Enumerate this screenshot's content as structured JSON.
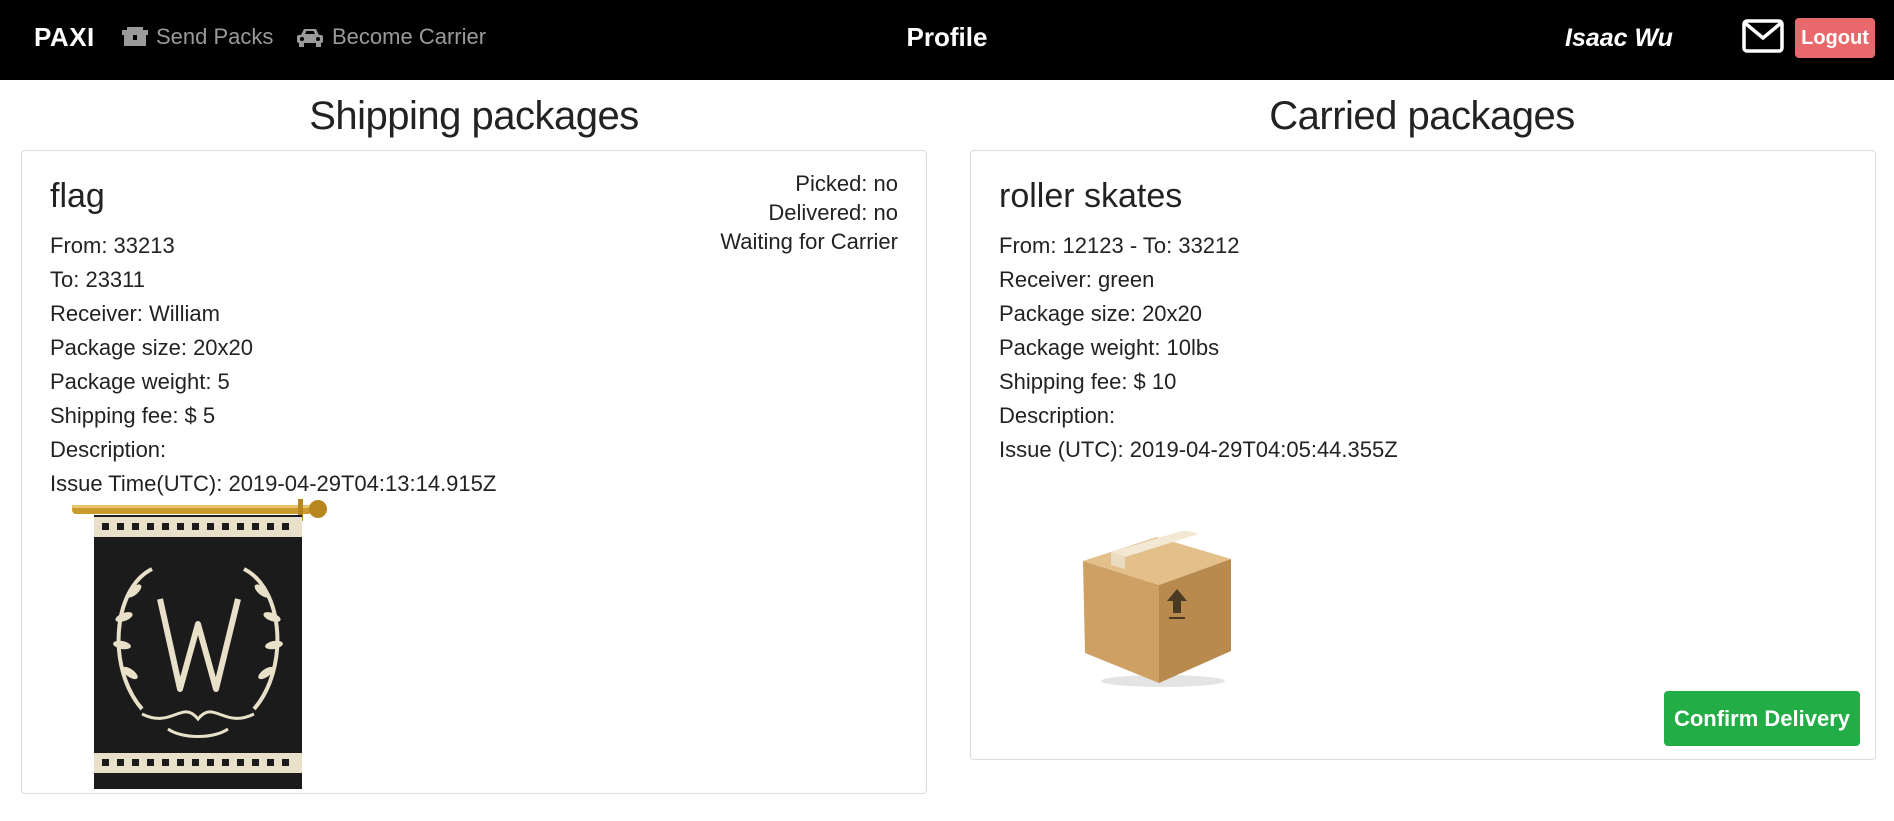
{
  "navbar": {
    "brand": "PAXI",
    "send_packs": "Send Packs",
    "become_carrier": "Become Carrier",
    "title": "Profile",
    "user_name": "Isaac Wu",
    "logout": "Logout"
  },
  "shipping": {
    "heading": "Shipping packages",
    "package": {
      "name": "flag",
      "from": "From: 33213",
      "to": "To: 23311",
      "receiver": "Receiver: William",
      "size": "Package size: 20x20",
      "weight": "Package weight: 5",
      "fee": "Shipping fee: $ 5",
      "description": "Description:",
      "issue_time": "Issue Time(UTC): 2019-04-29T04:13:14.915Z",
      "picked": "Picked: no",
      "delivered": "Delivered: no",
      "status": "Waiting for Carrier"
    }
  },
  "carried": {
    "heading": "Carried packages",
    "package": {
      "name": "roller skates",
      "route": "From: 12123 - To: 33212",
      "receiver": "Receiver: green",
      "size": "Package size: 20x20",
      "weight": "Package weight: 10lbs",
      "fee": "Shipping fee: $ 10",
      "description": "Description:",
      "issue_time": "Issue (UTC): 2019-04-29T04:05:44.355Z",
      "confirm": "Confirm Delivery"
    }
  },
  "colors": {
    "navbar_bg": "#000000",
    "logout_bg": "#e9686b",
    "confirm_bg": "#22ad46",
    "nav_link": "#9a9a9a"
  },
  "icons": [
    "boxes-icon",
    "car-icon",
    "mail-icon"
  ]
}
